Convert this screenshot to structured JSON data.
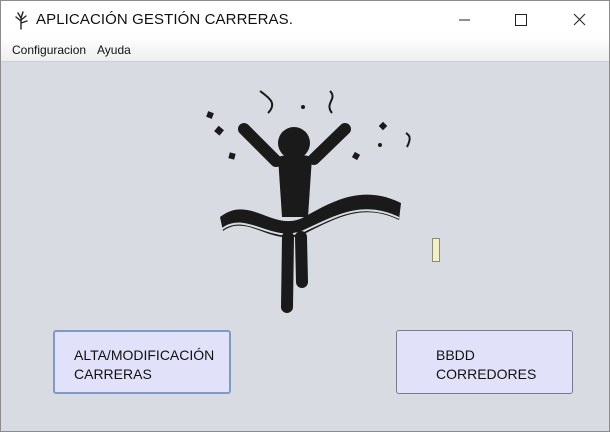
{
  "window": {
    "title": "APLICACIÓN GESTIÓN CARRERAS.",
    "controls": {
      "minimize": "minimize",
      "maximize": "maximize",
      "close": "close"
    }
  },
  "menu": [
    {
      "label": "Configuracion"
    },
    {
      "label": "Ayuda"
    }
  ],
  "main": {
    "illustration": "runner-finish-line-celebration-icon",
    "buttons": {
      "alta_line1": "ALTA/MODIFICACIÓN",
      "alta_line2": "CARRERAS",
      "bbdd_line1": "BBDD",
      "bbdd_line2": "CORREDORES"
    }
  },
  "colors": {
    "background": "#d8dce2",
    "button_fill": "#e1e1fa",
    "focus_border": "#7f9ac4",
    "icon": "#1a1a1a"
  }
}
